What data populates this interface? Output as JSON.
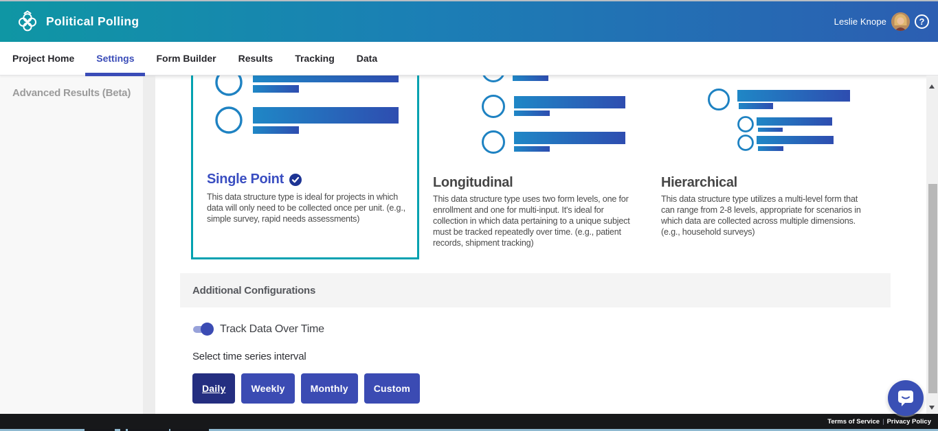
{
  "header": {
    "app_title": "Political Polling",
    "user_name": "Leslie Knope"
  },
  "icons": {
    "logo": "clover-logo",
    "help": "?",
    "selected_check": "check-circle",
    "chat": "chat-bubble",
    "scroll_up": "up-arrow",
    "scroll_down": "down-arrow"
  },
  "nav": {
    "items": [
      {
        "label": "Project Home",
        "active": false
      },
      {
        "label": "Settings",
        "active": true
      },
      {
        "label": "Form Builder",
        "active": false
      },
      {
        "label": "Results",
        "active": false
      },
      {
        "label": "Tracking",
        "active": false
      },
      {
        "label": "Data",
        "active": false
      }
    ]
  },
  "sidebar": {
    "items": [
      {
        "label": "Advanced Results (Beta)"
      }
    ]
  },
  "data_structure_cards": [
    {
      "title": "Single Point",
      "selected": true,
      "description": "This data structure type is ideal for projects in which data will only need to be collected once per unit. (e.g., simple survey, rapid needs assessments)"
    },
    {
      "title": "Longitudinal",
      "selected": false,
      "description": "This data structure type uses two form levels, one for enrollment and one for multi-input. It's ideal for collection in which data pertaining to a unique subject must be tracked repeatedly over time. (e.g., patient records, shipment tracking)"
    },
    {
      "title": "Hierarchical",
      "selected": false,
      "description": "This data structure type utilizes a multi-level form that can range from 2-8 levels, appropriate for scenarios in which data are collected across multiple dimensions. (e.g., household surveys)"
    }
  ],
  "additional_config": {
    "section_title": "Additional Configurations",
    "toggle_label": "Track Data Over Time",
    "toggle_on": true,
    "interval_prompt": "Select time series interval",
    "intervals": [
      {
        "label": "Daily",
        "selected": true
      },
      {
        "label": "Weekly",
        "selected": false
      },
      {
        "label": "Monthly",
        "selected": false
      },
      {
        "label": "Custom",
        "selected": false
      }
    ]
  },
  "footer": {
    "links": [
      "Terms of Service",
      "Privacy Policy"
    ],
    "separator": "|"
  },
  "colors": {
    "header_gradient_left": "#0f96a4",
    "header_gradient_right": "#2c5eb2",
    "accent_indigo": "#3a4cb8",
    "selected_card_teal": "#00a1b0",
    "illustration_blue_start": "#1f87c6",
    "illustration_blue_end": "#2e4db0",
    "selected_card_title": "#3a4ec1",
    "card_title": "#464646",
    "body_text": "#4a4a4a",
    "section_band_bg": "#f4f4f4",
    "interval_button_bg": "#3b4bb3",
    "interval_button_selected_bg": "#242e80",
    "toggle_track": "#98a2da",
    "toggle_thumb": "#3b4bb3",
    "footer_bg": "#17181a",
    "chat_bubble_bg": "#3a50b5"
  }
}
